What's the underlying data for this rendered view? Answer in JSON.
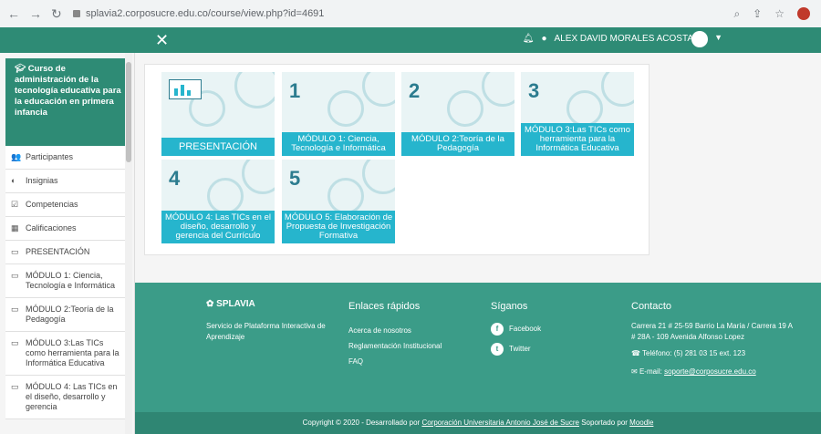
{
  "browser": {
    "url": "splavia2.corposucre.edu.co/course/view.php?id=4691"
  },
  "topbar": {
    "close_glyph": "✕",
    "user_name": "ALEX DAVID MORALES ACOSTA"
  },
  "sidebar": {
    "course_title": "Curso de administración de la tecnología educativa para la educación en primera infancia",
    "items": [
      {
        "icon": "👥",
        "label": "Participantes"
      },
      {
        "icon": "◐",
        "label": "Insignias"
      },
      {
        "icon": "☑",
        "label": "Competencias"
      },
      {
        "icon": "▦",
        "label": "Calificaciones"
      },
      {
        "icon": "▭",
        "label": "PRESENTACIÓN"
      },
      {
        "icon": "▭",
        "label": "MÓDULO 1: Ciencia, Tecnología e Informática"
      },
      {
        "icon": "▭",
        "label": "MÓDULO 2:Teoría de la Pedagogía"
      },
      {
        "icon": "▭",
        "label": "MÓDULO 3:Las TICs como herramienta para la Informática Educativa"
      },
      {
        "icon": "▭",
        "label": "MÓDULO 4: Las TICs en el diseño, desarrollo y gerencia"
      }
    ]
  },
  "tiles": [
    {
      "label": "PRESENTACIÓN",
      "num": ""
    },
    {
      "label": "MÓDULO 1: Ciencia, Tecnología e Informática",
      "num": "1"
    },
    {
      "label": "MÓDULO 2:Teoría de la Pedagogía",
      "num": "2"
    },
    {
      "label": "MÓDULO 3:Las TICs como herramienta para la Informática Educativa",
      "num": "3"
    },
    {
      "label": "MÓDULO 4: Las TICs en el diseño, desarrollo y gerencia del Currículo",
      "num": "4"
    },
    {
      "label": "MÓDULO 5: Elaboración de Propuesta de Investigación Formativa",
      "num": "5"
    }
  ],
  "footer": {
    "brand": "SPLAVIA",
    "tagline": "Servicio de Plataforma Interactiva de Aprendizaje",
    "links_title": "Enlaces rápidos",
    "links": [
      "Acerca de nosotros",
      "Reglamentación Institucional",
      "FAQ"
    ],
    "social_title": "Síganos",
    "facebook": "Facebook",
    "twitter": "Twitter",
    "contact_title": "Contacto",
    "address": "Carrera 21 # 25-59 Barrio La María / Carrera 19 A # 28A - 109 Avenida Alfonso Lopez",
    "phone": "Teléfono: (5) 281 03 15 ext. 123",
    "email_label": "E-mail: ",
    "email": "soporte@corposucre.edu.co",
    "copy_prefix": "Copyright © 2020 - Desarrollado por ",
    "copy_org": "Corporación Universitaria Antonio José de Sucre",
    "copy_mid": " Soportado por ",
    "copy_moodle": "Moodle"
  }
}
